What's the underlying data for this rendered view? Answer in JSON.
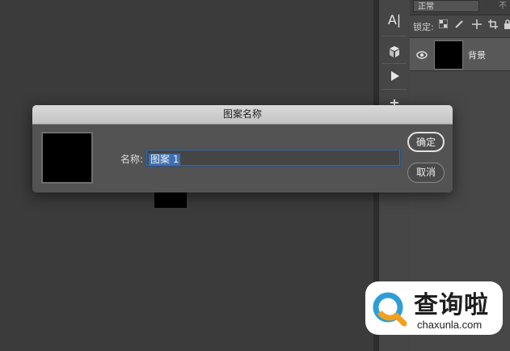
{
  "dialog": {
    "title": "图案名称",
    "name_label": "名称:",
    "name_value": "图案 1",
    "ok_label": "确定",
    "cancel_label": "取消"
  },
  "layers_panel": {
    "blend_mode": "正常",
    "opacity_label": "不",
    "lock_label": "锁定:",
    "layer_name": "背景"
  },
  "tools": {
    "text_tool_glyph": "A|"
  },
  "watermark": {
    "cn": "查询啦",
    "en": "chaxunla.com"
  },
  "colors": {
    "accent": "#3f6fb2",
    "dialog_bg": "#535353",
    "canvas_bg": "#3b3b3b"
  }
}
